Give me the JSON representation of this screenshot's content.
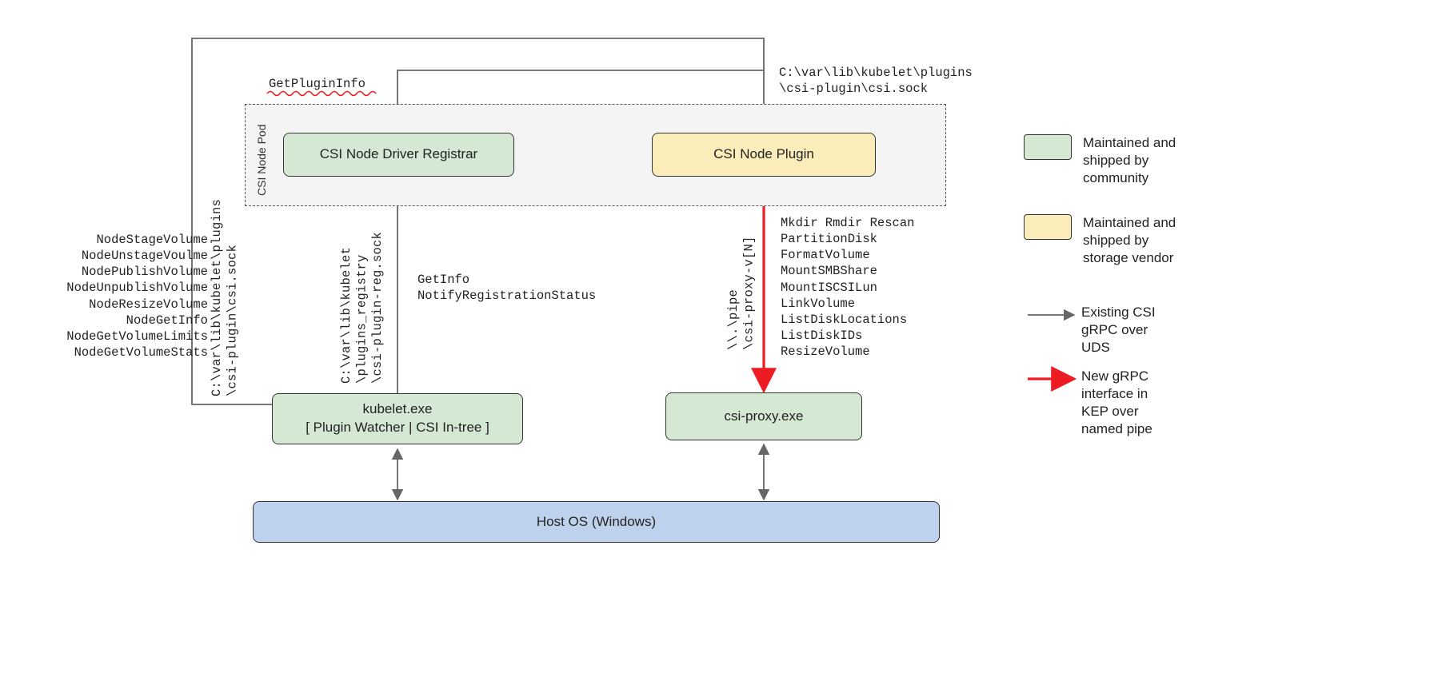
{
  "pod": {
    "label": "CSI Node Pod"
  },
  "boxes": {
    "registrar": "CSI Node Driver Registrar",
    "plugin": "CSI Node Plugin",
    "kubelet_l1": "kubelet.exe",
    "kubelet_l2": "[ Plugin Watcher | CSI In-tree ]",
    "csiproxy": "csi-proxy.exe",
    "hostos": "Host OS (Windows)"
  },
  "paths": {
    "kubelet_plugin_l1": "C:\\var\\lib\\kubelet\\plugins",
    "kubelet_plugin_l2": "\\csi-plugin\\csi.sock",
    "kubelet_registry_l1": "C:\\var\\lib\\kubelet",
    "kubelet_registry_l2": "\\plugins_registry",
    "kubelet_registry_l3": "\\csi-plugin-reg.sock",
    "pipe_l1": "\\\\.\\pipe",
    "pipe_l2": "\\csi-proxy-v[N]"
  },
  "labels": {
    "getplugininfo": "GetPluginInfo",
    "uds_top_l1": "C:\\var\\lib\\kubelet\\plugins",
    "uds_top_l2": "\\csi-plugin\\csi.sock",
    "getinfo": "GetInfo",
    "notify": "NotifyRegistrationStatus"
  },
  "node_ops": [
    "NodeStageVolume",
    "NodeUnstageVoulme",
    "NodePublishVolume",
    "NodeUnpublishVolume",
    "NodeResizeVolume",
    "NodeGetInfo",
    "NodeGetVolumeLimits",
    "NodeGetVolumeStats"
  ],
  "proxy_ops": [
    "Mkdir Rmdir Rescan",
    "PartitionDisk",
    "FormatVolume",
    "MountSMBShare",
    "MountISCSILun",
    "LinkVolume",
    "ListDiskLocations",
    "ListDiskIDs",
    "ResizeVolume"
  ],
  "legend": {
    "community": "Maintained and\nshipped by\ncommunity",
    "vendor": "Maintained and\nshipped by\nstorage vendor",
    "existing": "Existing CSI\ngRPC over\nUDS",
    "newgrpc": "New gRPC\ninterface in\nKEP over\nnamed pipe"
  },
  "colors": {
    "green": "#D4E8D3",
    "yellow": "#FBEDB9",
    "blue": "#BED2EE",
    "grey": "#666666",
    "red": "#ED1C24"
  }
}
